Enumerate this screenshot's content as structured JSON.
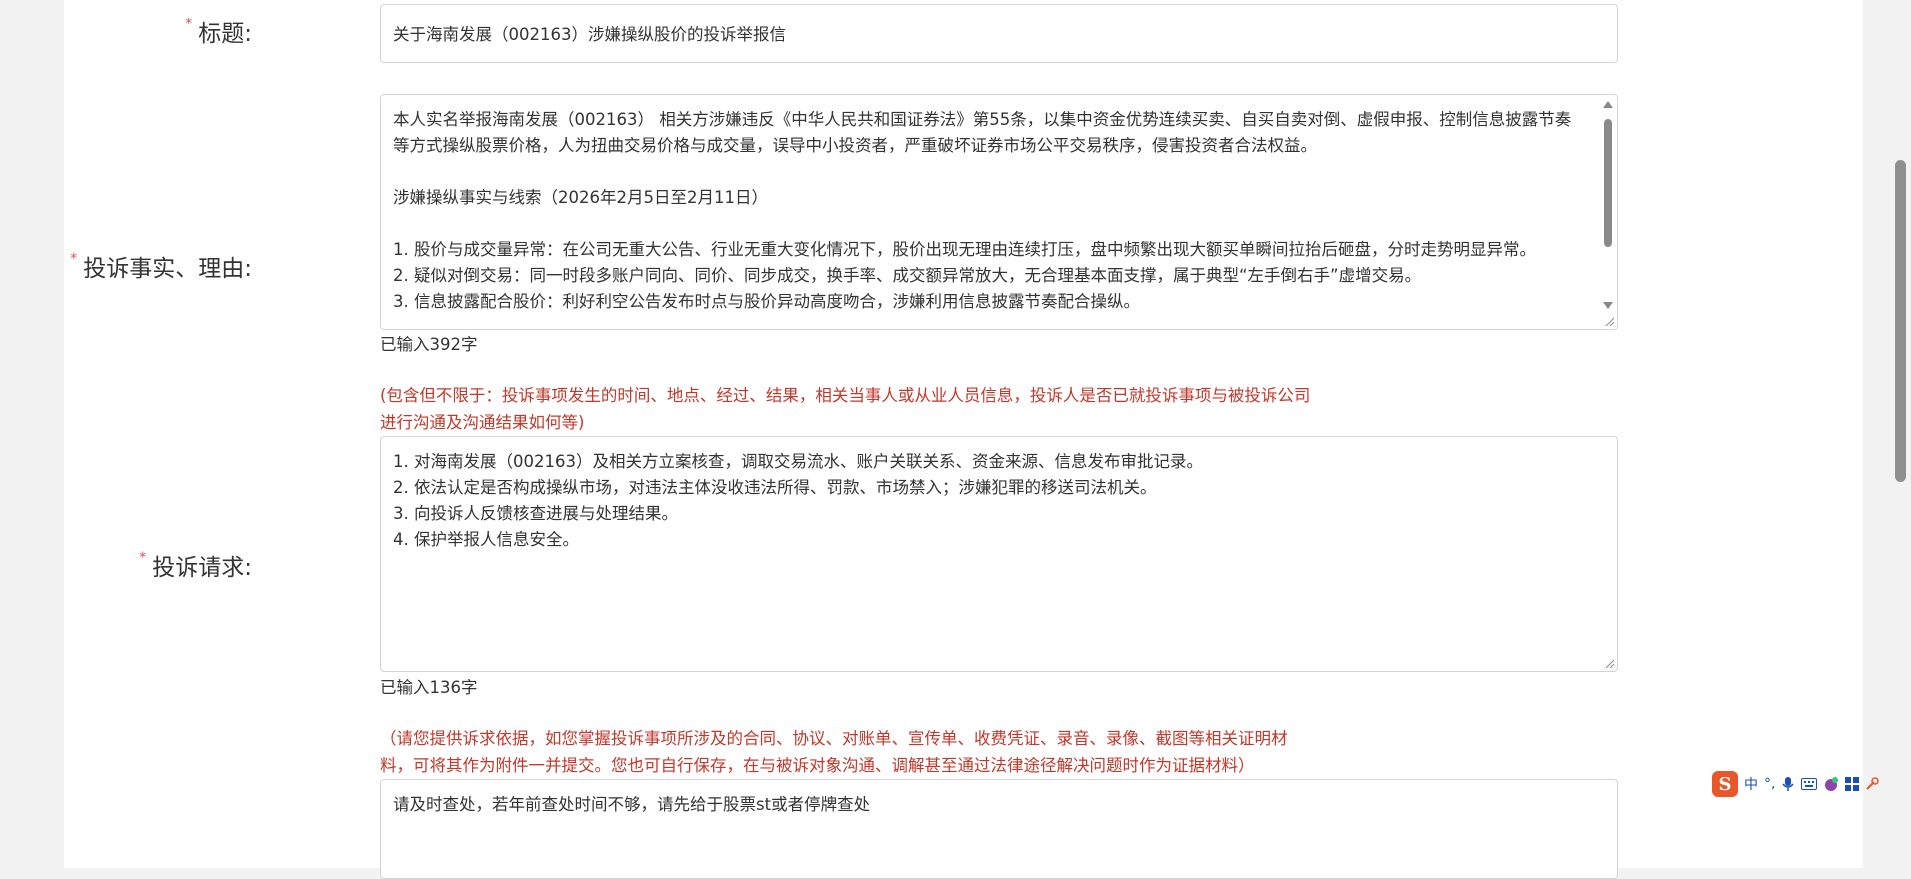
{
  "form": {
    "title": {
      "label": "标题:",
      "value": "关于海南发展（002163）涉嫌操纵股价的投诉举报信"
    },
    "facts": {
      "label": "投诉事实、理由:",
      "text": "本人实名举报海南发展（002163） 相关方涉嫌违反《中华人民共和国证券法》第55条，以集中资金优势连续买卖、自买自卖对倒、虚假申报、控制信息披露节奏等方式操纵股票价格，人为扭曲交易价格与成交量，误导中小投资者，严重破坏证券市场公平交易秩序，侵害投资者合法权益。\n\n涉嫌操纵事实与线索（2026年2月5日至2月11日）\n\n1. 股价与成交量异常：在公司无重大公告、行业无重大变化情况下，股价出现无理由连续打压，盘中频繁出现大额买单瞬间拉抬后砸盘，分时走势明显异常。\n2. 疑似对倒交易：同一时段多账户同向、同价、同步成交，换手率、成交额异常放大，无合理基本面支撑，属于典型“左手倒右手”虚增交易。\n3. 信息披露配合股价：利好利空公告发布时点与股价异动高度吻合，涉嫌利用信息披露节奏配合操纵。",
      "counter": "已输入392字"
    },
    "hint1": "(包含但不限于：投诉事项发生的时间、地点、经过、结果，相关当事人或从业人员信息，投诉人是否已就投诉事项与被投诉公司进行沟通及沟通结果如何等)",
    "requests": {
      "label": "投诉请求:",
      "text": "1. 对海南发展（002163）及相关方立案核查，调取交易流水、账户关联关系、资金来源、信息发布审批记录。\n2. 依法认定是否构成操纵市场，对违法主体没收违法所得、罚款、市场禁入；涉嫌犯罪的移送司法机关。\n3. 向投诉人反馈核查进展与处理结果。\n4. 保护举报人信息安全。",
      "counter": "已输入136字"
    },
    "hint2": "（请您提供诉求依据，如您掌握投诉事项所涉及的合同、协议、对账单、宣传单、收费凭证、录音、录像、截图等相关证明材料，可将其作为附件一并提交。您也可自行保存，在与被诉对象沟通、调解甚至通过法律途径解决问题时作为证据材料）",
    "extra": {
      "text": "请及时查处，若年前查处时间不够，请先给于股票st或者停牌查处"
    },
    "required_mark": "*"
  },
  "ime_toolbar": {
    "logo": "S",
    "mode": "中",
    "items": [
      "punct-icon",
      "mic-icon",
      "keyboard-icon",
      "skin-icon",
      "grid-icon",
      "tool-icon"
    ],
    "punct": "°,"
  },
  "colors": {
    "required": "#d9534f",
    "hint": "#c0392b",
    "ime_logo": "#e8572a"
  }
}
